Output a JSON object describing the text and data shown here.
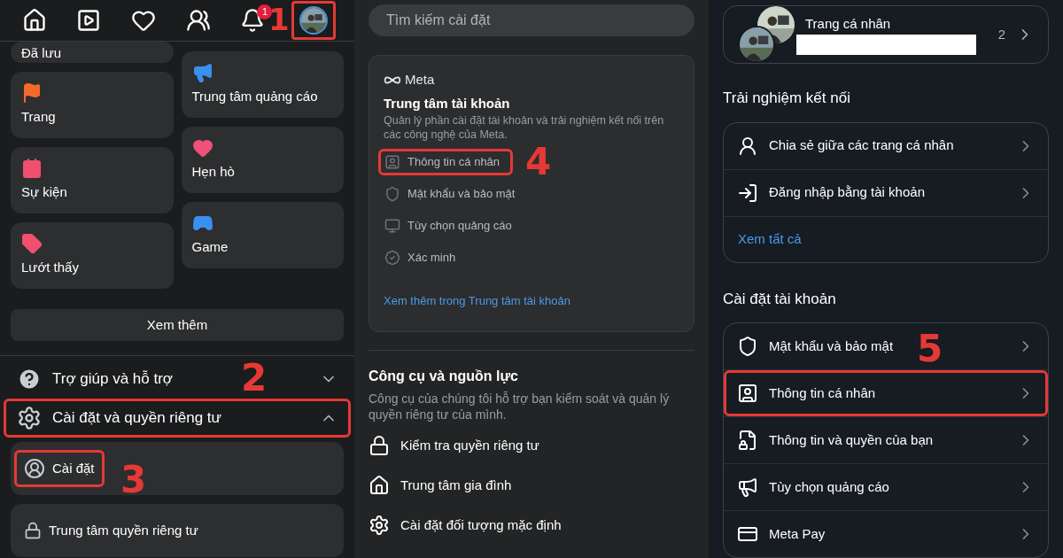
{
  "nav": {
    "notification_badge": "1",
    "profile_button": {
      "highlighted": true,
      "step": "1"
    }
  },
  "shortcuts": {
    "column_1": [
      {
        "label": "Đã lưu",
        "cut": true
      },
      {
        "label": "Trang",
        "cut": false
      },
      {
        "label": "Sự kiện",
        "cut": false
      },
      {
        "label": "Lướt thấy",
        "cut": false
      }
    ],
    "column_2": [
      {
        "label": "Trung tâm quảng cáo",
        "cut": false
      },
      {
        "label": "Hẹn hò",
        "cut": false
      },
      {
        "label": "Game",
        "cut": false
      }
    ]
  },
  "see_more_button": "Xem thêm",
  "menu": [
    {
      "label": "Trợ giúp và hỗ trợ",
      "expanded": false,
      "highlighted": false,
      "step": "2"
    },
    {
      "label": "Cài đặt và quyền riêng tư",
      "expanded": true,
      "highlighted": true,
      "children": [
        {
          "label": "Cài đặt",
          "highlighted": true,
          "step": "3"
        },
        {
          "label": "Trung tâm quyền riêng tư",
          "highlighted": false
        }
      ]
    }
  ],
  "settings_search": {
    "placeholder": "Tìm kiếm cài đặt"
  },
  "accounts_center": {
    "brand": "Meta",
    "title": "Trung tâm tài khoản",
    "description": "Quản lý phần cài đặt tài khoản và trải nghiệm kết nối trên các công nghệ của Meta.",
    "items": [
      {
        "label": "Thông tin cá nhân",
        "highlighted": true,
        "step": "4"
      },
      {
        "label": "Mật khẩu và bảo mật",
        "highlighted": false
      },
      {
        "label": "Tùy chọn quảng cáo",
        "highlighted": false
      },
      {
        "label": "Xác minh",
        "highlighted": false
      }
    ],
    "link": "Xem thêm trong Trung tâm tài khoản"
  },
  "tools": {
    "title": "Công cụ và nguồn lực",
    "description": "Công cụ của chúng tôi hỗ trợ bạn kiểm soát và quản lý quyền riêng tư của mình.",
    "items": [
      "Kiểm tra quyền riêng tư",
      "Trung tâm gia đình",
      "Cài đặt đối tượng mặc định"
    ]
  },
  "profile_card": {
    "label": "Trang cá nhân",
    "count": "2"
  },
  "sections": [
    {
      "title": "Trải nghiệm kết nối",
      "items": [
        {
          "label": "Chia sẻ giữa các trang cá nhân",
          "highlighted": false
        },
        {
          "label": "Đăng nhập bằng tài khoản",
          "highlighted": false
        }
      ],
      "link": "Xem tất cả"
    },
    {
      "title": "Cài đặt tài khoản",
      "items": [
        {
          "label": "Mật khẩu và bảo mật",
          "highlighted": false,
          "step": "5"
        },
        {
          "label": "Thông tin cá nhân",
          "highlighted": true
        },
        {
          "label": "Thông tin và quyền của bạn",
          "highlighted": false
        },
        {
          "label": "Tùy chọn quảng cáo",
          "highlighted": false
        },
        {
          "label": "Meta Pay",
          "highlighted": false
        }
      ]
    }
  ]
}
